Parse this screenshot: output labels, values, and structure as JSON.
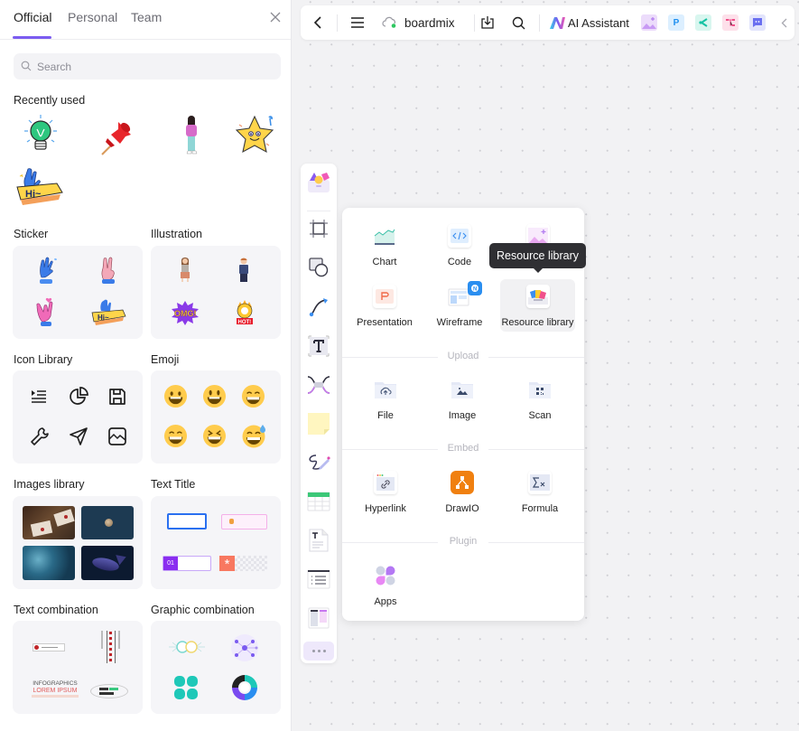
{
  "panel": {
    "tabs": [
      {
        "label": "Official",
        "active": true
      },
      {
        "label": "Personal",
        "active": false
      },
      {
        "label": "Team",
        "active": false
      }
    ],
    "search": {
      "placeholder": "Search",
      "value": ""
    },
    "recently_used": {
      "title": "Recently used",
      "items": [
        "lightbulb-sticker",
        "red-pushpin-sticker",
        "woman-illustration",
        "smiling-star-sticker",
        "hi-waving-hand-sticker"
      ]
    },
    "categories": [
      {
        "title": "Sticker",
        "previews": [
          "ok-hand",
          "peace-hand",
          "rock-hand-heart",
          "hi-hand-banner"
        ]
      },
      {
        "title": "Illustration",
        "previews": [
          "woman-figure",
          "man-figure",
          "omg-burst",
          "hot-skull"
        ]
      },
      {
        "title": "Icon Library",
        "previews": [
          "list-icon",
          "pie-chart-icon",
          "save-icon",
          "wrench-icon",
          "send-icon",
          "image-icon"
        ]
      },
      {
        "title": "Emoji",
        "previews": [
          "grinning",
          "smiley",
          "grin",
          "beaming",
          "laughing",
          "sweat-smile"
        ]
      },
      {
        "title": "Images library",
        "previews": [
          "envelopes-photo",
          "moon-photo",
          "ocean-waves-photo",
          "fish-photo"
        ]
      },
      {
        "title": "Text Title",
        "previews": [
          "blue-frame-title",
          "pink-badge-title",
          "numbered-title",
          "asterisk-title"
        ],
        "numbered_label": "01"
      },
      {
        "title": "Text combination",
        "previews": [
          "banner-text",
          "vertical-text",
          "infographics-text",
          "portfolio-text"
        ],
        "infographics_line1": "INFOGRAPHICS",
        "infographics_line2": "LOREM IPSUM"
      },
      {
        "title": "Graphic combination",
        "previews": [
          "linked-circles",
          "network-graph",
          "four-petal-grid",
          "cycle-diagram"
        ]
      }
    ]
  },
  "topbar": {
    "back_icon": "chevron-left-icon",
    "menu_icon": "hamburger-icon",
    "cloud_status": "synced",
    "board_name": "boardmix",
    "export_icon": "download-icon",
    "search_icon": "search-icon",
    "ai_label": "AI Assistant",
    "plugins": [
      {
        "name": "ai-image",
        "glyph": "",
        "bg": "#ecdcfb",
        "fg": "#b27cf0"
      },
      {
        "name": "presentation",
        "glyph": "P",
        "bg": "#dcefff",
        "fg": "#1e8ff0"
      },
      {
        "name": "mindmap",
        "glyph": "<",
        "bg": "#d8f6ef",
        "fg": "#14c2a3"
      },
      {
        "name": "flowchart",
        "glyph": "",
        "bg": "#fde0ea",
        "fg": "#f0508a"
      },
      {
        "name": "chat",
        "glyph": "",
        "bg": "#e2e4fc",
        "fg": "#6a6ff0"
      }
    ],
    "collapse_icon": "chevron-left-icon"
  },
  "rail": {
    "items": [
      "resource-library",
      "frame",
      "shape",
      "connector",
      "text",
      "mindmap-node",
      "sticky-note",
      "pen",
      "table",
      "document",
      "list",
      "kanban"
    ],
    "more_label": "..."
  },
  "menu": {
    "items": [
      {
        "label": "Chart"
      },
      {
        "label": "Code"
      },
      {
        "label": "AI image"
      },
      {
        "label": "Presentation"
      },
      {
        "label": "Wireframe"
      },
      {
        "label": "Resource library"
      }
    ],
    "groups": {
      "upload": {
        "title": "Upload",
        "items": [
          {
            "label": "File"
          },
          {
            "label": "Image"
          },
          {
            "label": "Scan"
          }
        ]
      },
      "embed": {
        "title": "Embed",
        "items": [
          {
            "label": "Hyperlink"
          },
          {
            "label": "DrawIO"
          },
          {
            "label": "Formula"
          }
        ]
      },
      "plugin": {
        "title": "Plugin",
        "items": [
          {
            "label": "Apps"
          }
        ]
      }
    },
    "hovered": "Resource library",
    "tooltip": "Resource library"
  },
  "colors": {
    "accent": "#7b5cf0",
    "tab_active_underline": "#7b5cf0",
    "canvas_bg": "#f2f2f4",
    "card_bg": "#f5f5f8",
    "tooltip_bg": "#2f2f33"
  }
}
